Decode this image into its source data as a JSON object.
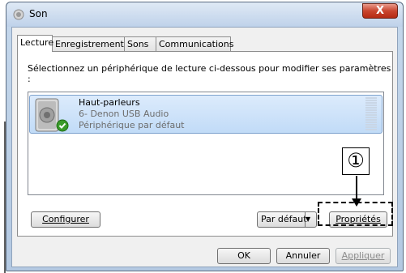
{
  "window": {
    "title": "Son",
    "close_label": "X"
  },
  "tabs": [
    {
      "label": "Lecture",
      "active": true
    },
    {
      "label": "Enregistrement",
      "active": false
    },
    {
      "label": "Sons",
      "active": false
    },
    {
      "label": "Communications",
      "active": false
    }
  ],
  "panel": {
    "instruction": "Sélectionnez un périphérique de lecture ci-dessous pour modifier ses paramètres :"
  },
  "device": {
    "name": "Haut-parleurs",
    "description": "6- Denon USB Audio",
    "status": "Périphérique par défaut",
    "icon": "speaker-icon",
    "default_badge_icon": "check-icon"
  },
  "buttons": {
    "configure": "Configurer",
    "default": "Par défaut",
    "properties": "Propriétés",
    "ok": "OK",
    "cancel": "Annuler",
    "apply": "Appliquer"
  },
  "callout": {
    "number": "①"
  },
  "colors": {
    "selection": "#c1dbf7",
    "close_button": "#c9452e"
  }
}
